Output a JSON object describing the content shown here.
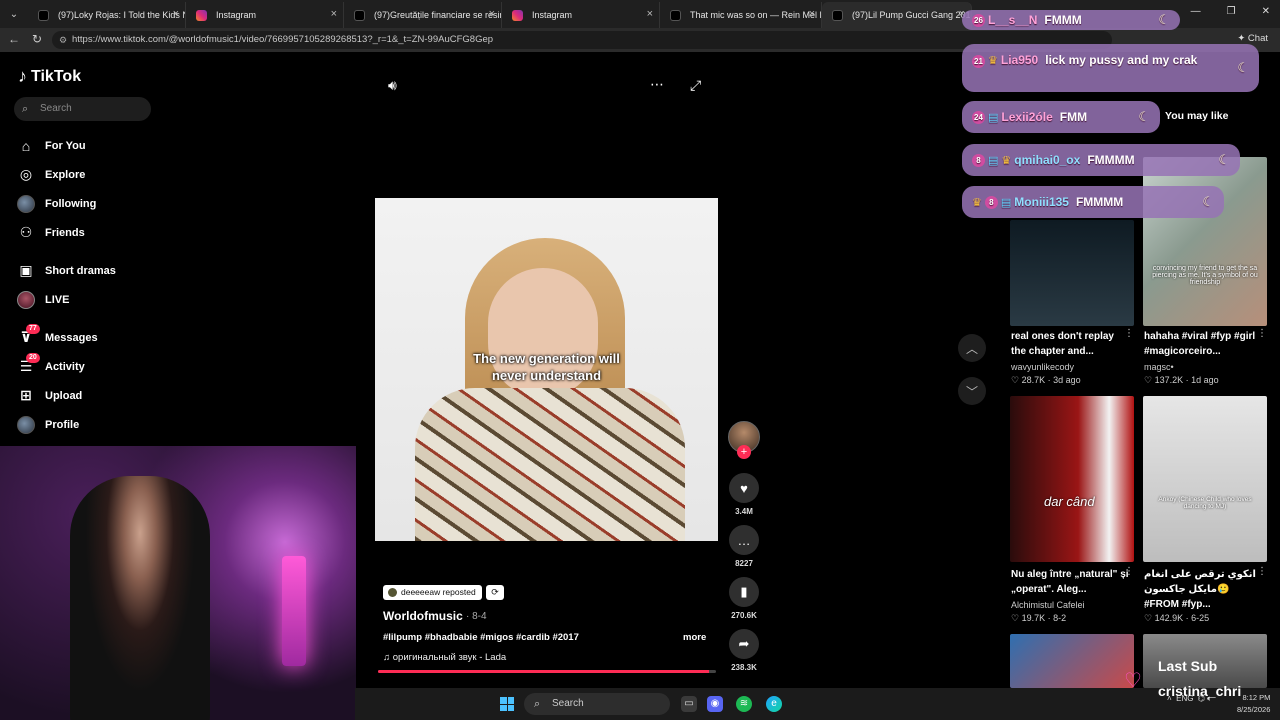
{
  "browser": {
    "tabs": [
      {
        "label": "(97)Loky Rojas: I Told the Kids No!",
        "favicon": "tiktok"
      },
      {
        "label": "Instagram",
        "favicon": "instagram"
      },
      {
        "label": "(97)Greutățile financiare se resimt",
        "favicon": "tiktok"
      },
      {
        "label": "Instagram",
        "favicon": "instagram"
      },
      {
        "label": "That mic was so on — Rein Mel Fi",
        "favicon": "tiktok"
      },
      {
        "label": "(97)Lil Pump Gucci Gang 201",
        "favicon": "tiktok"
      }
    ],
    "url": "https://www.tiktok.com/@worldofmusic1/video/7669957105289268513?_r=1&_t=ZN-99AuCFG8Gep",
    "chat_label": "Chat"
  },
  "sidebar": {
    "logo": "TikTok",
    "search_placeholder": "Search",
    "items": [
      {
        "label": "For You",
        "icon": "home-icon"
      },
      {
        "label": "Explore",
        "icon": "compass-icon"
      },
      {
        "label": "Following",
        "icon": "following-avatar-icon"
      },
      {
        "label": "Friends",
        "icon": "friends-icon"
      },
      {
        "label": "Short dramas",
        "icon": "film-icon"
      },
      {
        "label": "LIVE",
        "icon": "live-icon"
      },
      {
        "label": "Messages",
        "icon": "message-icon",
        "badge": "77"
      },
      {
        "label": "Activity",
        "icon": "activity-icon",
        "badge": "20"
      },
      {
        "label": "Upload",
        "icon": "upload-icon"
      },
      {
        "label": "Profile",
        "icon": "profile-icon"
      }
    ]
  },
  "video": {
    "caption_line1": "The new generation will",
    "caption_line2": "never understand",
    "reposted_by": "deeeeeaw reposted",
    "author": "Worldofmusic",
    "date": "· 8-4",
    "hashtags": "#lilpump #bhadbabie #migos #cardib #2017",
    "more_label": "more",
    "sound": "оригинальный звук - Lada",
    "progress": 0.98
  },
  "actions": {
    "likes": "3.4M",
    "comments": "8227",
    "saves": "270.6K",
    "shares": "238.3K"
  },
  "recommendations": {
    "header": "You may like",
    "items": [
      {
        "title": "real ones don't replay the chapter and...",
        "author": "wavyunlikecody",
        "likes": "28.7K",
        "age": "3d ago",
        "overlay": ""
      },
      {
        "title": "hahaha #viral #fyp #girl #magicorceiro...",
        "author": "magsc•",
        "likes": "137.2K",
        "age": "1d ago",
        "overlay": "convincing my friend to get the sa piercing as me. It's a symbol of ou friendship"
      },
      {
        "title": "Nu aleg între „natural\" și „operat\". Aleg...",
        "author": "Alchimistul Cafelei",
        "likes": "19.7K",
        "age": "8-2",
        "overlay": "dar când"
      },
      {
        "title": "انكوي ترقص على انغام مايكل جاكسون🥲 #FROM #fyp...",
        "author": ".",
        "likes": "142.9K",
        "age": "6-25",
        "overlay": "Ankoy (Chinese Child who loves dancing to MJ)"
      }
    ]
  },
  "chat": [
    {
      "level": "26",
      "user": "L__s__N",
      "text": "FMMM"
    },
    {
      "level": "21",
      "user": "Lia950",
      "text": "lick my pussy and my crak"
    },
    {
      "level": "24",
      "user": "Lexii2óle",
      "text": "FMM"
    },
    {
      "level": "8",
      "user": "qmihai0_ox",
      "text": "FMMMM"
    },
    {
      "level": "8",
      "user": "Moniii135",
      "text": "FMMMM"
    }
  ],
  "stream": {
    "last_sub_label": "Last Sub",
    "last_sub_name": "cristina_chri"
  },
  "taskbar": {
    "search_placeholder": "Search",
    "lang": "ENG",
    "time": "8:12 PM",
    "date": "8/25/2026"
  },
  "colors": {
    "accent": "#fe2c55",
    "chat_bubble": "#9673b4",
    "webcam_light": "#ff5ad8"
  }
}
